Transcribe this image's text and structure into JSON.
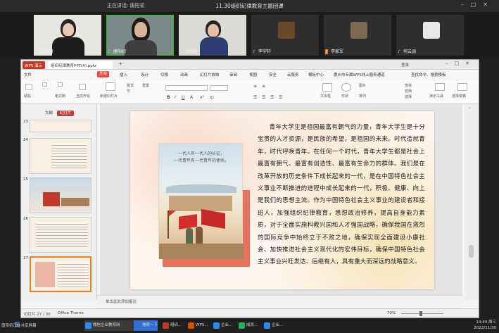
{
  "meeting": {
    "speaking_label": "正在讲话: 唐阳初",
    "title": "11.30组织纪律教育主题团课"
  },
  "participants": [
    {
      "name": "魏晓丹"
    },
    {
      "name": "唐阳初"
    },
    {
      "name": "邓桐杰"
    },
    {
      "name": "李宇轩"
    },
    {
      "name": "李家军"
    },
    {
      "name": "何云涵"
    }
  ],
  "wps": {
    "home_tab": "WPS 演示",
    "doc_tab": "组织纪律教育PPT(A).pptx",
    "login": "登录",
    "menu": [
      "文件",
      "开始",
      "插入",
      "设计",
      "切换",
      "动画",
      "幻灯片放映",
      "审阅",
      "视图",
      "安全",
      "云服务",
      "模板中心",
      "惠州市专属WPS线上服务通道",
      "查找命令、搜索模板"
    ],
    "ribbon": [
      "格式刷",
      "粘贴",
      "当前开始",
      "新建幻灯片",
      "版式",
      "节",
      "重置",
      "文本框",
      "形状",
      "图片",
      "排列",
      "查找",
      "替换",
      "选择",
      "演示工具",
      "选择窗格"
    ],
    "panel_tabs": [
      "大纲",
      "幻灯片"
    ],
    "thumb_numbers": [
      "23",
      "24",
      "25",
      "26",
      "27"
    ],
    "slide_paragraph": "青年大学生是祖国最富有朝气的力量，青年大学生是十分宝贵的人才资源，是民族的希望，是祖国的未来。时代造就青年，时代呼唤青年。在任何一个时代，青年大学生都是社会上最富有朝气、最富有创造性、最富有生命力的群体。我们是在改革开放的历史条件下成长起来的一代，是在中国特色社会主义事业不断推进的进程中成长起来的一代，积极、健康、向上是我们的思想主流。作为中国特色社会主义事业的建设者和接班人，加强组织纪律教育，思想政治修养，提高自身能力素质，对于全面实施科教兴国和人才强国战略，确保我国在激烈的国际竞争中始终立于不败之地，确保实现全面建设小康社会、加快推进社会主义现代化的宏伟目标，确保中国特色社会主义事业兴旺发达、后继有人，具有重大而深远的战略意义。",
    "poster_text_line1": "一代人有一代人的长征，",
    "poster_text_line2": "一代青年有一代青年的使命。",
    "notes_placeholder": "单击此处添加备注",
    "status_slide": "幻灯片 27 / 30",
    "status_theme": "Office Theme",
    "zoom": "70%"
  },
  "taskbar": {
    "share_label": "唐阳初正在共享屏幕",
    "items": [
      "微信企业教育网",
      "搜索一下",
      "组织...",
      "WPS...",
      "企业...",
      "成员...",
      "企业..."
    ],
    "time": "14:49 周三",
    "date": "2022/11/30"
  }
}
